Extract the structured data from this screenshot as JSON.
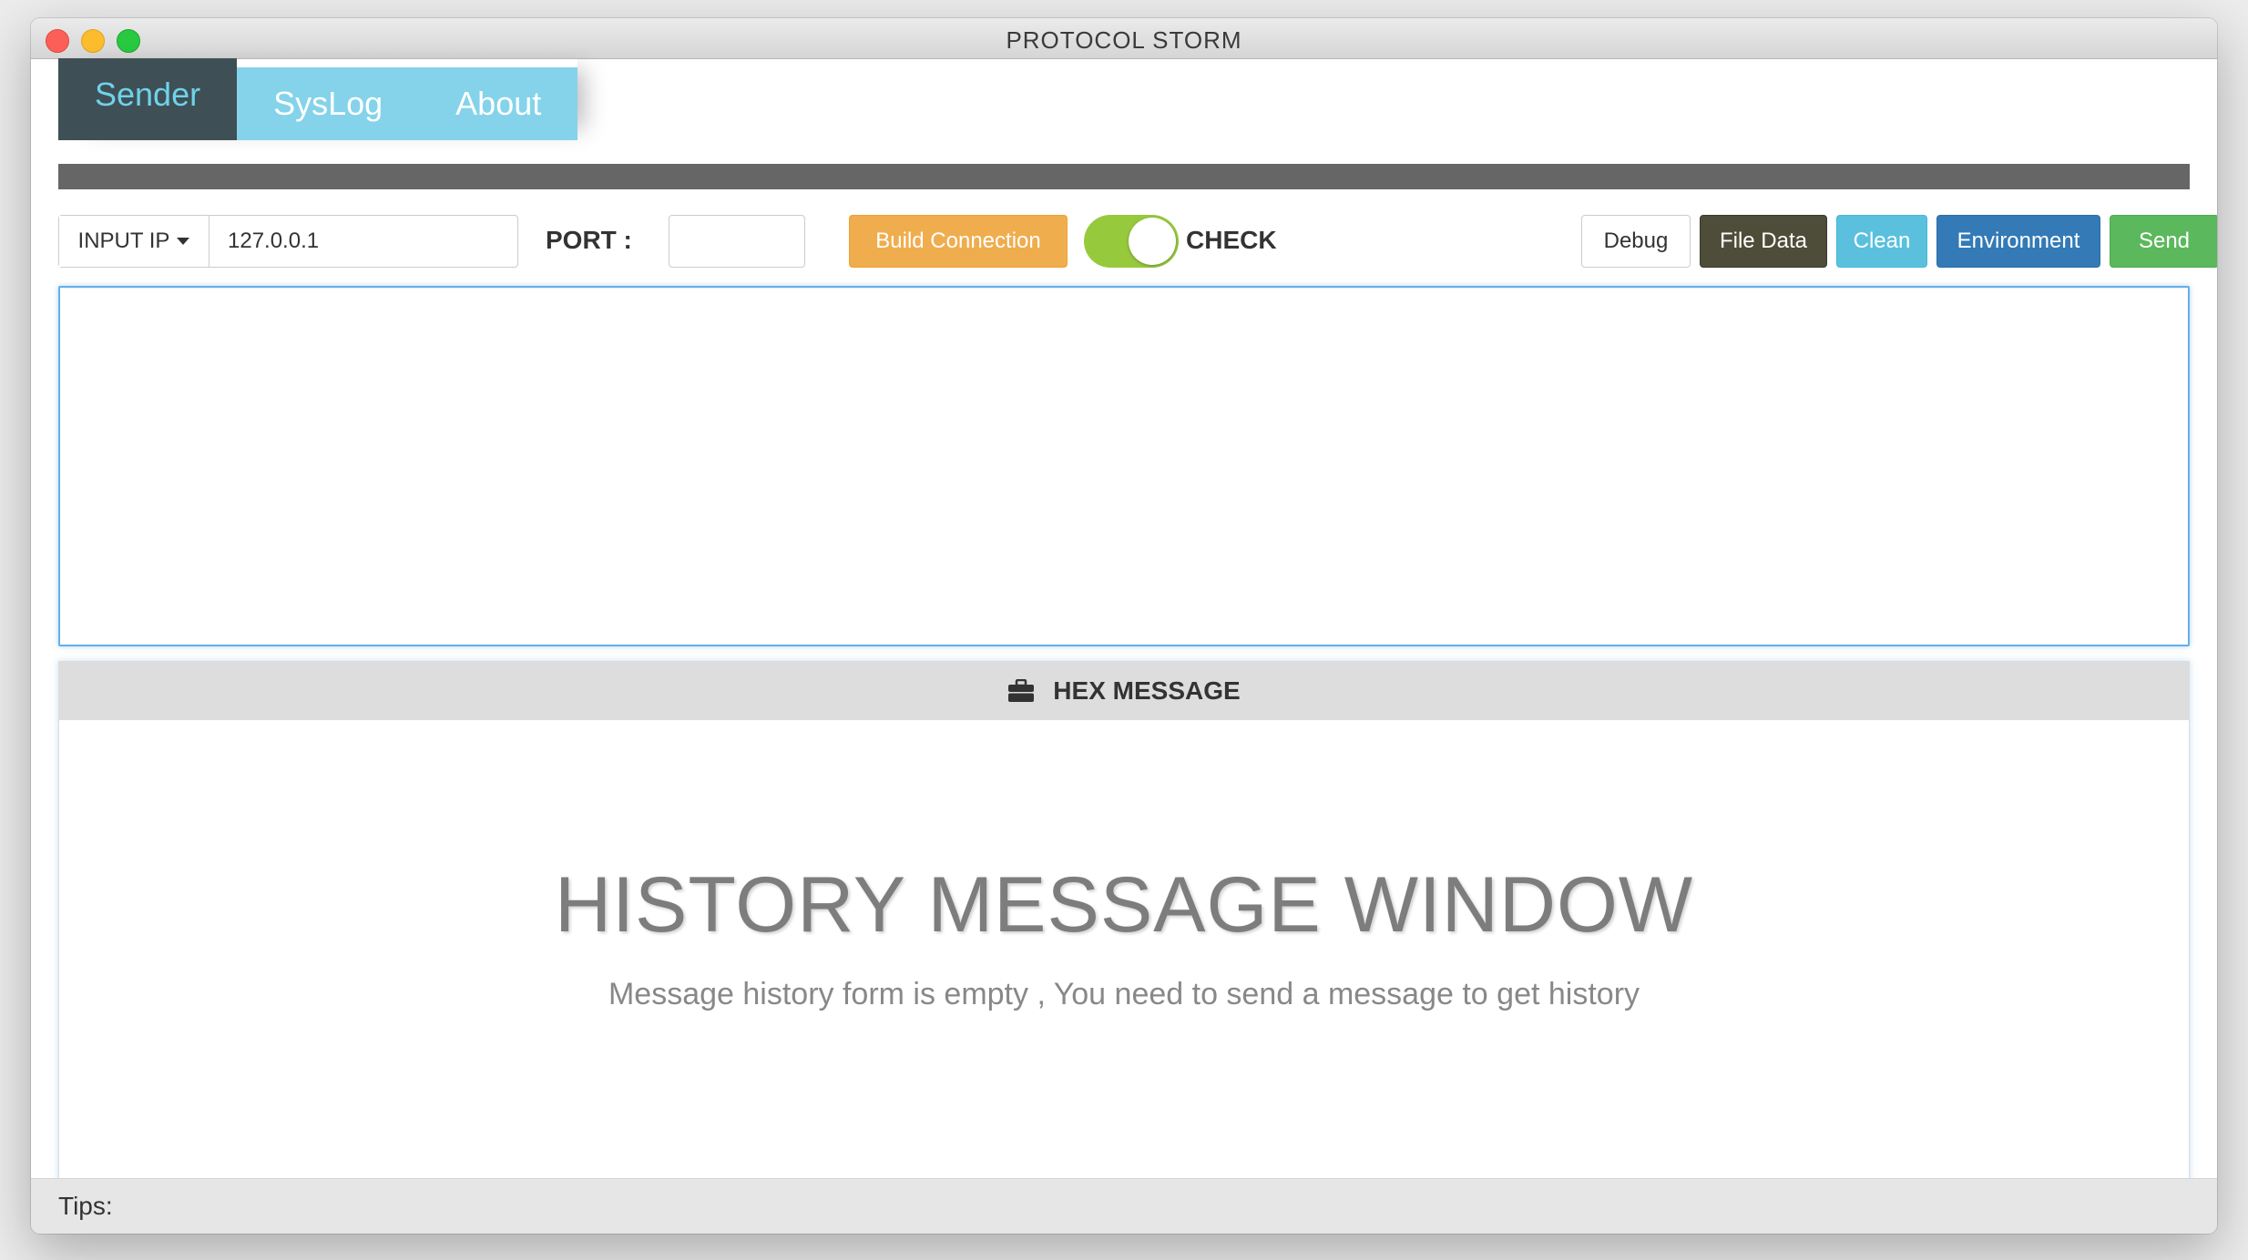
{
  "window": {
    "title": "PROTOCOL STORM"
  },
  "tabs": [
    {
      "label": "Sender",
      "active": true
    },
    {
      "label": "SysLog",
      "active": false
    },
    {
      "label": "About",
      "active": false
    }
  ],
  "toolbar": {
    "ip_select_label": "INPUT IP",
    "ip_value": "127.0.0.1",
    "port_label": "PORT :",
    "port_value": "",
    "build_label": "Build Connection",
    "check_label": "CHECK",
    "check_on": true,
    "debug_label": "Debug",
    "file_data_label": "File Data",
    "clean_label": "Clean",
    "environment_label": "Environment",
    "send_label": "Send"
  },
  "message": {
    "value": ""
  },
  "hex_panel": {
    "title": "HEX MESSAGE",
    "icon": "briefcase-icon",
    "history_title": "HISTORY MESSAGE WINDOW",
    "history_subtitle": "Message history form is empty , You need to send a message to get history"
  },
  "status": {
    "tips_label": "Tips:"
  },
  "colors": {
    "tab_active_bg": "#3f4f56",
    "tab_active_text": "#6ed3e8",
    "tab_bg": "#84d3ea",
    "build": "#f0ad4e",
    "toggle_on": "#97c93d",
    "file_data": "#4d4d3a",
    "clean": "#5bc0de",
    "environment": "#337ab7",
    "send": "#5cb85c"
  }
}
